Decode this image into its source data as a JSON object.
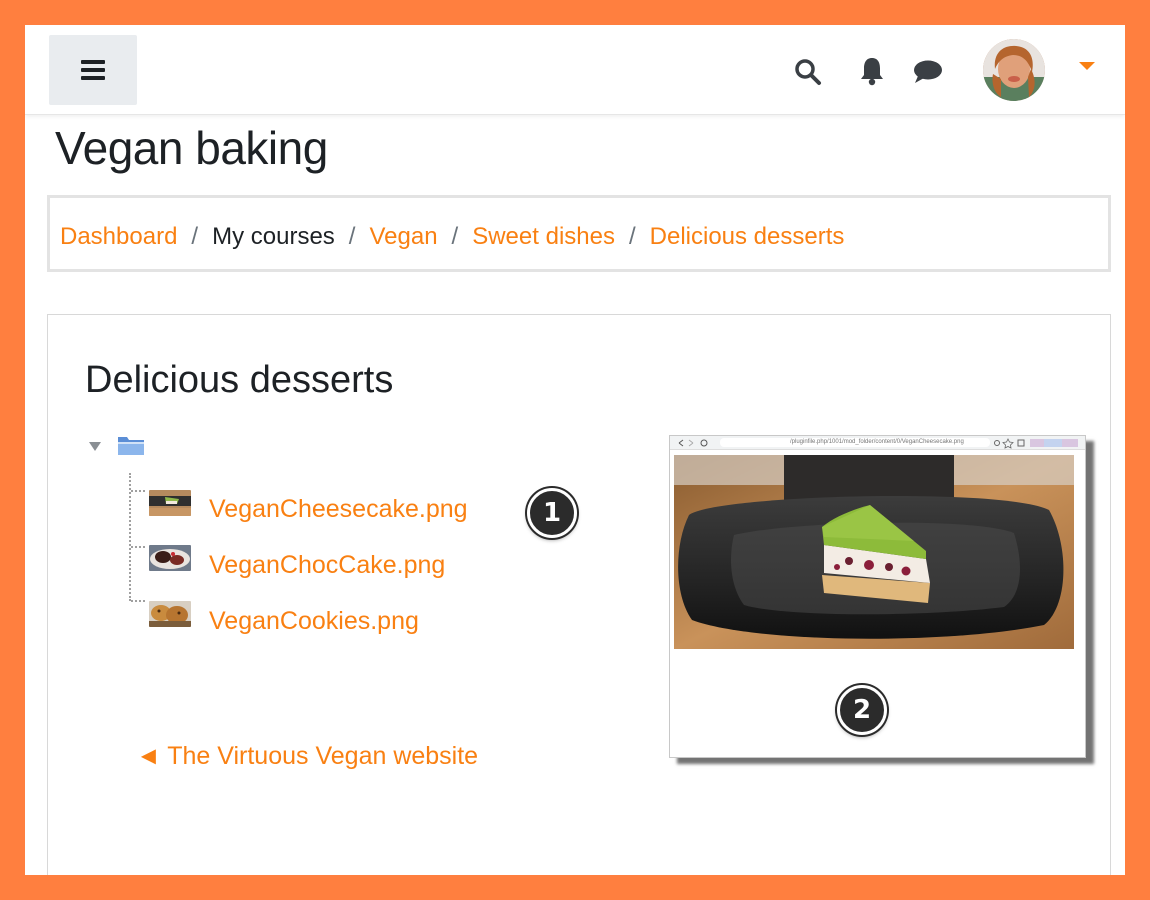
{
  "navbar": {
    "menu_icon": "hamburger-icon",
    "search_icon": "search-icon",
    "notifications_icon": "bell-icon",
    "messages_icon": "chat-bubble-icon",
    "user_menu_icon": "caret-down-icon",
    "accent_color": "#f98012"
  },
  "page": {
    "title": "Vegan baking"
  },
  "breadcrumb": {
    "items": [
      {
        "label": "Dashboard",
        "link": true
      },
      {
        "label": "My courses",
        "link": false
      },
      {
        "label": "Vegan",
        "link": true
      },
      {
        "label": "Sweet dishes",
        "link": true
      },
      {
        "label": "Delicious desserts",
        "link": true
      }
    ],
    "separator": "/"
  },
  "folder": {
    "title": "Delicious desserts",
    "files": [
      {
        "name": "VeganCheesecake.png",
        "icon": "cheesecake-thumbnail"
      },
      {
        "name": "VeganChocCake.png",
        "icon": "choc-cake-thumbnail"
      },
      {
        "name": "VeganCookies.png",
        "icon": "cookies-thumbnail"
      }
    ],
    "external_link": "◄ The Virtuous Vegan website"
  },
  "callouts": [
    "1",
    "2"
  ],
  "preview": {
    "url_text": "/pluginfile.php/1001/mod_folder/content/0/VeganCheesecake.png"
  }
}
